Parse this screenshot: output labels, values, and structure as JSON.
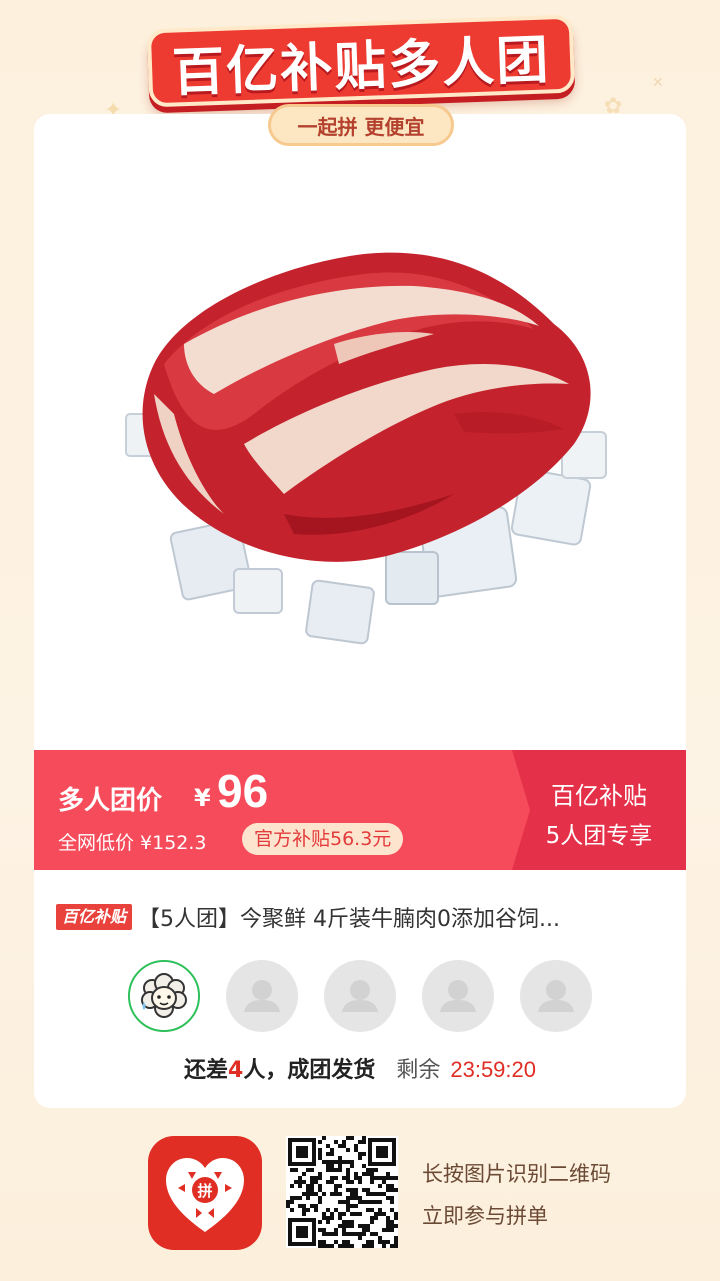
{
  "banner": {
    "title": "百亿补贴多人团",
    "subtitle": "一起拼 更便宜"
  },
  "colors": {
    "brand_red": "#e02e24",
    "price_bar": "#f64b5a",
    "leader_ring": "#2fbf5b",
    "background": "#fdf3e2"
  },
  "price": {
    "group_label": "多人团价",
    "currency": "¥",
    "value": "96",
    "low_price_label": "全网低价 ¥152.3",
    "subsidy": "官方补贴56.3元",
    "right_line1": "百亿补贴",
    "right_line2": "5人团专享"
  },
  "product": {
    "tag": "百亿补贴",
    "title": "【5人团】今聚鲜 4斤装牛腩肉0添加谷饲...",
    "image_icon": "beef-on-ice-image"
  },
  "group": {
    "avatars": [
      "leader-sheep-avatar",
      "empty-avatar",
      "empty-avatar",
      "empty-avatar",
      "empty-avatar"
    ],
    "status_prefix": "还差",
    "status_count": "4",
    "status_suffix": "人，成团发货",
    "remain_label": "剩余",
    "timer": "23:59:20"
  },
  "footer": {
    "logo_icon": "pinduoduo-logo-icon",
    "qr_icon": "qr-code",
    "line1": "长按图片识别二维码",
    "line2": "立即参与拼单"
  }
}
